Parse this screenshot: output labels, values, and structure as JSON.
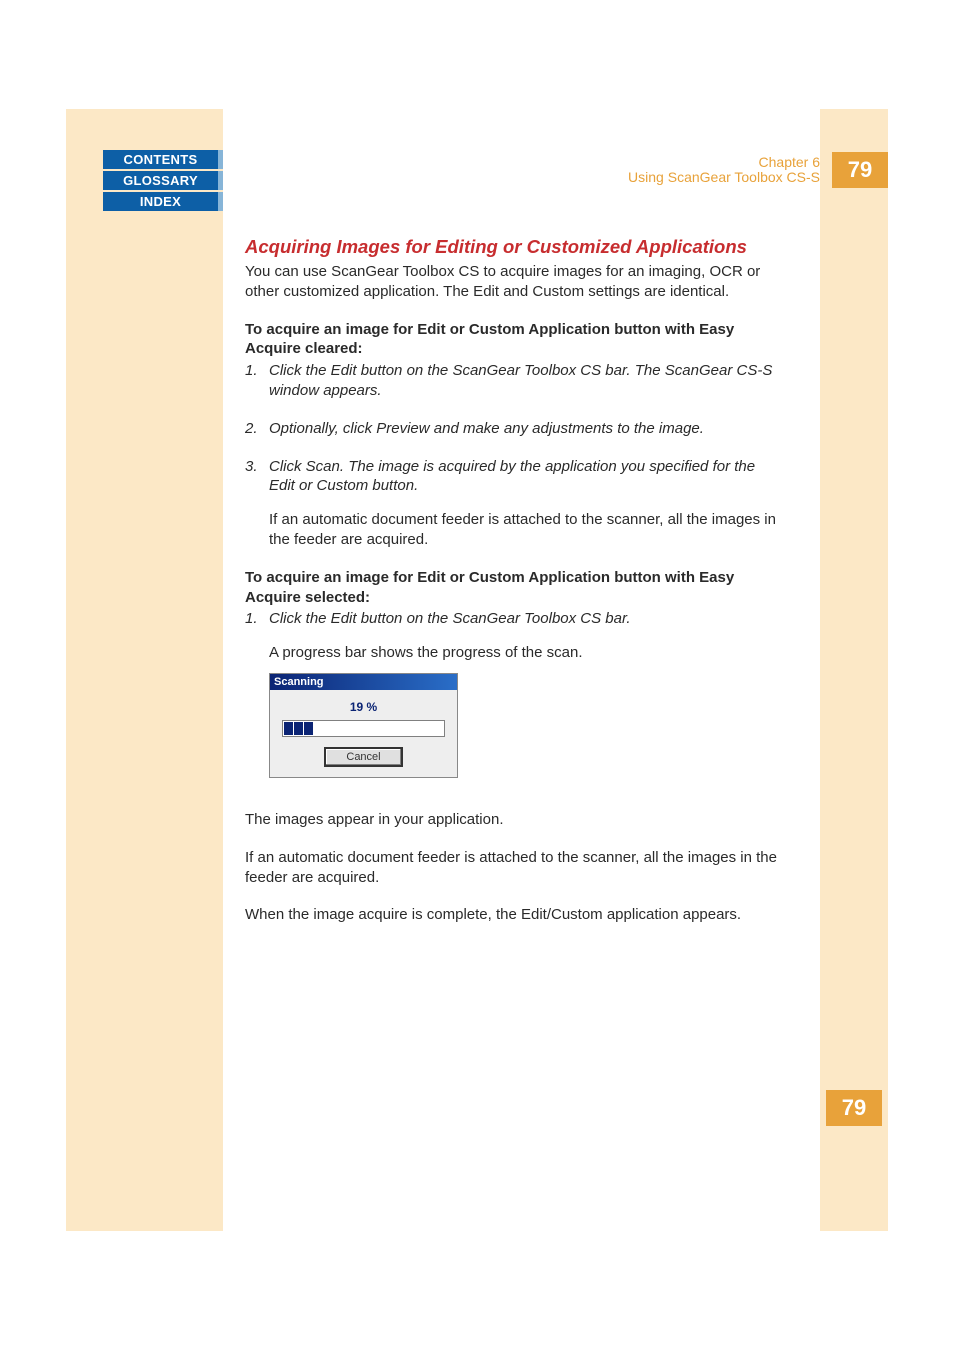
{
  "nav": {
    "contents": "CONTENTS",
    "glossary": "GLOSSARY",
    "index": "INDEX"
  },
  "header": {
    "chapter": "Chapter 6",
    "subtitle": "Using ScanGear Toolbox CS-S",
    "page_number": "79"
  },
  "section": {
    "title": "Acquiring Images for Editing or Customized Applications",
    "intro": "You can use ScanGear Toolbox CS to acquire images for an imaging, OCR or other customized application. The Edit and Custom settings are identical.",
    "procedure1_heading": "To acquire an image for Edit or Custom Application button with Easy Acquire cleared:",
    "p1_step1_num": "1.",
    "p1_step1": "Click the Edit button on the ScanGear Toolbox CS bar. The ScanGear CS-S window appears.",
    "p1_step2_num": "2.",
    "p1_step2": "Optionally, click Preview and make any adjustments to the image.",
    "p1_step3_num": "3.",
    "p1_step3": "Click Scan. The image is acquired by the application you specified for the Edit or Custom button.",
    "p1_step3_note": "If an automatic document feeder is attached to the scanner, all the images in the feeder are acquired.",
    "procedure2_heading": "To acquire an image for Edit or Custom Application button with Easy Acquire selected:",
    "p2_step1_num": "1.",
    "p2_step1": "Click the Edit button on the ScanGear Toolbox CS bar.",
    "p2_step1_note": "A progress bar shows the progress of the scan.",
    "after1": "The images appear in your application.",
    "after2": "If an automatic document feeder is attached to the scanner, all the images in the feeder are acquired.",
    "after3": "When the image acquire is complete, the Edit/Custom application appears."
  },
  "dialog": {
    "title": "Scanning",
    "percent": "19 %",
    "cancel": "Cancel"
  }
}
